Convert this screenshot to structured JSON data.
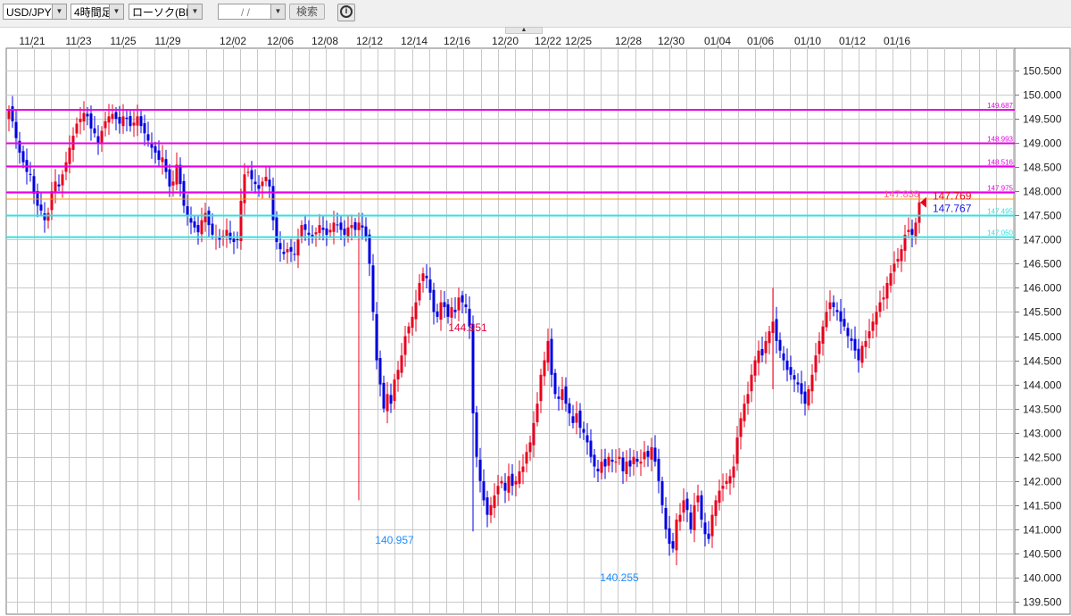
{
  "toolbar": {
    "symbol": "USD/JPY",
    "timeframe": "4時間足",
    "price_type": "ローソク(BID)",
    "date_placeholder": "/ /",
    "search_label": "検索",
    "info_glyph": "i"
  },
  "chart_data": {
    "type": "candlestick",
    "ylim": [
      139.5,
      150.5
    ],
    "y_ticks": [
      "150.500",
      "150.000",
      "149.500",
      "149.000",
      "148.500",
      "148.000",
      "147.500",
      "147.000",
      "146.500",
      "146.000",
      "145.500",
      "145.000",
      "144.500",
      "144.000",
      "143.500",
      "143.000",
      "142.500",
      "142.000",
      "141.500",
      "141.000",
      "140.500",
      "140.000",
      "139.500"
    ],
    "x_labels": [
      "11/21",
      "11/23",
      "11/25",
      "11/29",
      "12/02",
      "12/06",
      "12/08",
      "12/12",
      "12/14",
      "12/16",
      "12/20",
      "12/22",
      "12/25",
      "12/28",
      "12/30",
      "01/04",
      "01/06",
      "01/10",
      "01/12",
      "01/16"
    ],
    "horizontal_lines": [
      {
        "value": 149.687,
        "label": "149.687",
        "color": "#e600e6"
      },
      {
        "value": 148.993,
        "label": "148.993",
        "color": "#e600e6"
      },
      {
        "value": 148.516,
        "label": "148.516",
        "color": "#e600e6"
      },
      {
        "value": 147.975,
        "label": "147.975",
        "color": "#e600e6"
      },
      {
        "value": 147.838,
        "label": "147.838",
        "color": "#ff9900"
      },
      {
        "value": 147.495,
        "label": "147.495",
        "color": "#33e0e0"
      },
      {
        "value": 147.05,
        "label": "147.050",
        "color": "#33e0e0"
      }
    ],
    "annotations": [
      {
        "label": "144.951",
        "value": 144.951,
        "color": "#e0003c"
      },
      {
        "label": "140.957",
        "value": 140.957,
        "color": "#1e8cff"
      },
      {
        "label": "140.255",
        "value": 140.255,
        "color": "#1e8cff"
      }
    ],
    "current": {
      "ask_label": "147.769",
      "bid_label": "147.767",
      "value": 147.769
    },
    "up_color": "#e8001c",
    "down_color": "#0000e0",
    "closes": [
      149.7,
      149.45,
      149.1,
      148.8,
      148.6,
      148.4,
      148.35,
      147.95,
      147.7,
      147.6,
      147.4,
      147.55,
      148.0,
      148.2,
      148.1,
      148.35,
      148.6,
      148.9,
      149.15,
      149.4,
      149.5,
      149.62,
      149.55,
      149.3,
      149.2,
      149.0,
      149.25,
      149.45,
      149.55,
      149.6,
      149.5,
      149.4,
      149.55,
      149.5,
      149.35,
      149.42,
      149.55,
      149.35,
      149.2,
      149.05,
      148.9,
      148.8,
      148.65,
      148.7,
      148.4,
      148.1,
      148.2,
      148.55,
      148.15,
      147.7,
      147.5,
      147.35,
      147.25,
      147.15,
      147.4,
      147.55,
      147.3,
      147.1,
      147.05,
      147.0,
      147.08,
      147.2,
      147.0,
      146.95,
      147.0,
      147.8,
      148.35,
      148.4,
      148.25,
      148.15,
      148.05,
      148.2,
      148.3,
      148.1,
      147.4,
      146.95,
      146.8,
      146.7,
      146.8,
      146.75,
      146.7,
      147.0,
      147.3,
      147.2,
      147.1,
      147.05,
      147.15,
      147.3,
      147.2,
      147.1,
      147.2,
      147.35,
      147.3,
      147.2,
      147.1,
      147.25,
      147.3,
      147.2,
      147.35,
      147.25,
      147.05,
      146.5,
      145.5,
      144.5,
      144.0,
      143.5,
      143.8,
      143.6,
      144.1,
      144.3,
      144.6,
      145.0,
      145.2,
      145.4,
      145.7,
      146.1,
      146.3,
      146.2,
      145.9,
      145.5,
      145.4,
      145.7,
      145.6,
      145.4,
      145.6,
      145.5,
      145.8,
      145.7,
      145.6,
      145.2,
      143.4,
      142.5,
      142.0,
      141.6,
      141.3,
      141.5,
      141.7,
      141.9,
      142.0,
      141.8,
      142.1,
      141.9,
      142.0,
      142.2,
      142.3,
      142.6,
      142.8,
      143.2,
      143.6,
      144.2,
      144.5,
      144.9,
      144.2,
      143.8,
      143.7,
      143.9,
      143.6,
      143.4,
      143.2,
      143.4,
      143.1,
      143.0,
      142.8,
      142.5,
      142.3,
      142.2,
      142.4,
      142.3,
      142.5,
      142.4,
      142.4,
      142.5,
      142.2,
      142.4,
      142.3,
      142.5,
      142.4,
      142.4,
      142.6,
      142.5,
      142.7,
      142.4,
      142.0,
      141.5,
      141.0,
      140.7,
      140.6,
      141.2,
      141.3,
      141.6,
      141.4,
      141.0,
      141.5,
      141.7,
      141.2,
      140.9,
      140.8,
      141.3,
      141.6,
      141.8,
      141.9,
      142.0,
      142.1,
      142.3,
      142.9,
      143.3,
      143.6,
      143.8,
      144.2,
      144.5,
      144.7,
      144.6,
      144.9,
      145.1,
      145.3,
      144.9,
      144.7,
      144.5,
      144.3,
      144.2,
      144.1,
      144.0,
      143.8,
      143.6,
      143.9,
      144.2,
      144.6,
      144.9,
      145.2,
      145.5,
      145.7,
      145.6,
      145.5,
      145.3,
      145.2,
      145.0,
      144.9,
      144.7,
      144.5,
      144.8,
      144.9,
      145.1,
      145.3,
      145.5,
      145.7,
      145.8,
      146.1,
      146.3,
      146.5,
      146.6,
      146.8,
      147.1,
      147.2,
      147.1,
      147.35,
      147.769
    ],
    "spikes": [
      {
        "index": 98,
        "low": 141.6
      },
      {
        "index": 130,
        "low": 140.957
      },
      {
        "index": 187,
        "low": 140.255
      },
      {
        "index": 214,
        "low": 143.9,
        "high": 146.0
      }
    ],
    "pane": {
      "vertical_grid_count": 59
    }
  }
}
